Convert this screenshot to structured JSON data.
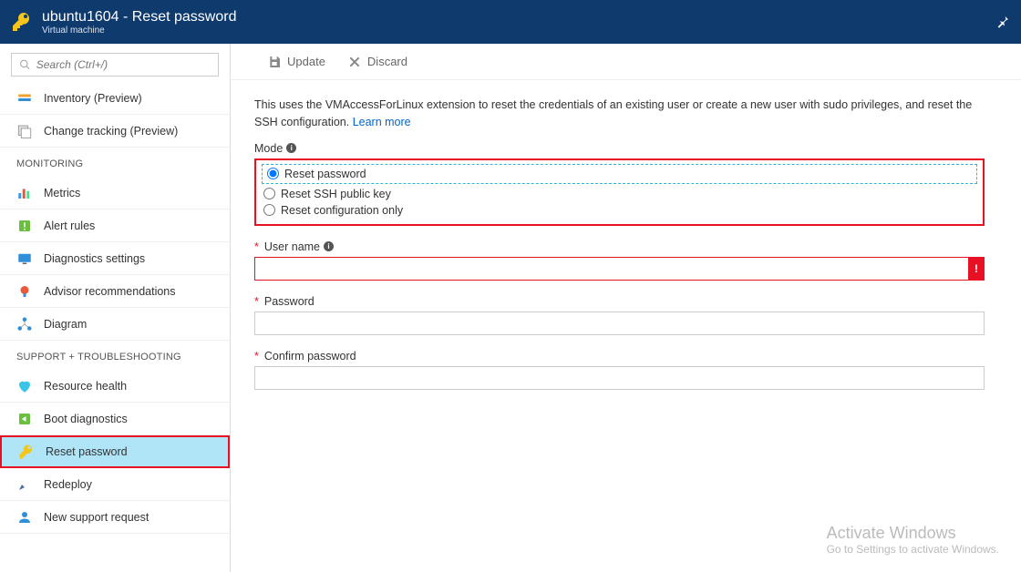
{
  "header": {
    "title": "ubuntu1604 - Reset password",
    "subtitle": "Virtual machine"
  },
  "search": {
    "placeholder": "Search (Ctrl+/)"
  },
  "sidebar": {
    "items": [
      {
        "label": "Inventory (Preview)",
        "icon": "inventory"
      },
      {
        "label": "Change tracking (Preview)",
        "icon": "change-tracking"
      }
    ],
    "monitoring_title": "MONITORING",
    "monitoring": [
      {
        "label": "Metrics",
        "icon": "metrics"
      },
      {
        "label": "Alert rules",
        "icon": "alert"
      },
      {
        "label": "Diagnostics settings",
        "icon": "diagnostics"
      },
      {
        "label": "Advisor recommendations",
        "icon": "advisor"
      },
      {
        "label": "Diagram",
        "icon": "diagram"
      }
    ],
    "support_title": "SUPPORT + TROUBLESHOOTING",
    "support": [
      {
        "label": "Resource health",
        "icon": "health"
      },
      {
        "label": "Boot diagnostics",
        "icon": "boot"
      },
      {
        "label": "Reset password",
        "icon": "key",
        "active": true,
        "highlight": true
      },
      {
        "label": "Redeploy",
        "icon": "redeploy"
      },
      {
        "label": "New support request",
        "icon": "support"
      }
    ]
  },
  "toolbar": {
    "save": "Update",
    "discard": "Discard"
  },
  "form": {
    "description": "This uses the VMAccessForLinux extension to reset the credentials of an existing user or create a new user with sudo privileges, and reset the SSH configuration. ",
    "learn_more": "Learn more",
    "mode_label": "Mode",
    "modes": [
      {
        "label": "Reset password",
        "checked": true
      },
      {
        "label": "Reset SSH public key",
        "checked": false
      },
      {
        "label": "Reset configuration only",
        "checked": false
      }
    ],
    "username_label": "User name",
    "username_value": "",
    "password_label": "Password",
    "password_value": "",
    "confirm_label": "Confirm password",
    "confirm_value": ""
  },
  "watermark": {
    "title": "Activate Windows",
    "subtitle": "Go to Settings to activate Windows."
  }
}
